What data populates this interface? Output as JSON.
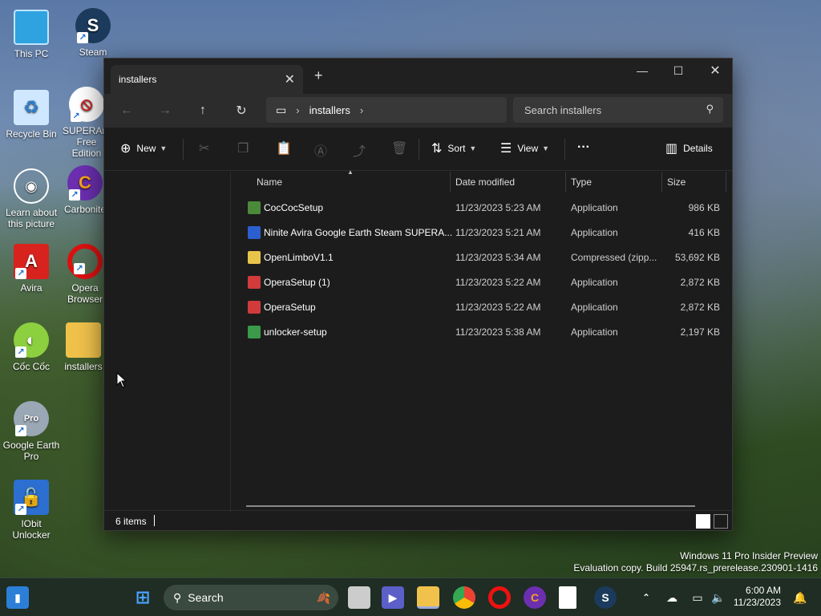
{
  "desktop": {
    "icons": [
      {
        "label": "This PC"
      },
      {
        "label": "Steam"
      },
      {
        "label": "Recycle Bin"
      },
      {
        "label": "SUPERAntiSpyware Free Edition"
      },
      {
        "label": "Learn about this picture"
      },
      {
        "label": "Carbonite"
      },
      {
        "label": "Avira"
      },
      {
        "label": "Opera Browser"
      },
      {
        "label": "Cốc Cốc"
      },
      {
        "label": "installers"
      },
      {
        "label": "Google Earth Pro"
      },
      {
        "label": "IObit Unlocker"
      }
    ],
    "watermark": {
      "line1": "Windows 11 Pro Insider Preview",
      "line2": "Evaluation copy. Build 25947.rs_prerelease.230901-1416"
    }
  },
  "explorer": {
    "tab_title": "installers",
    "address": {
      "location": "installers"
    },
    "search_placeholder": "Search installers",
    "toolbar": {
      "new_label": "New",
      "sort_label": "Sort",
      "view_label": "View",
      "more_label": "···",
      "details_label": "Details"
    },
    "columns": [
      "Name",
      "Date modified",
      "Type",
      "Size"
    ],
    "files": [
      {
        "name": "CocCocSetup",
        "date": "11/23/2023 5:23 AM",
        "type": "Application",
        "size": "986 KB",
        "color": "#4a8a3a"
      },
      {
        "name": "Ninite Avira Google Earth Steam SUPERA...",
        "date": "11/23/2023 5:21 AM",
        "type": "Application",
        "size": "416 KB",
        "color": "#2b5fd0"
      },
      {
        "name": "OpenLimboV1.1",
        "date": "11/23/2023 5:34 AM",
        "type": "Compressed (zipp...",
        "size": "53,692 KB",
        "color": "#e8c44a"
      },
      {
        "name": "OperaSetup (1)",
        "date": "11/23/2023 5:22 AM",
        "type": "Application",
        "size": "2,872 KB",
        "color": "#d13b3b"
      },
      {
        "name": "OperaSetup",
        "date": "11/23/2023 5:22 AM",
        "type": "Application",
        "size": "2,872 KB",
        "color": "#d13b3b"
      },
      {
        "name": "unlocker-setup",
        "date": "11/23/2023 5:38 AM",
        "type": "Application",
        "size": "2,197 KB",
        "color": "#3a9a4a"
      }
    ],
    "status": {
      "item_count": "6 items"
    }
  },
  "taskbar": {
    "search_label": "Search",
    "time": "6:00 AM",
    "date": "11/23/2023"
  }
}
